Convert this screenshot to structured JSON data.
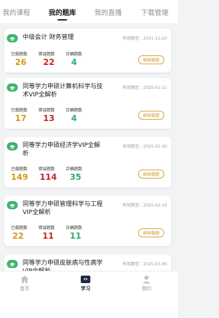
{
  "tabs": [
    {
      "label": "我的课程"
    },
    {
      "label": "我的题库"
    },
    {
      "label": "我的直播"
    },
    {
      "label": "下载管理"
    }
  ],
  "labels": {
    "done": "已做题数",
    "wrong": "错误题数",
    "right": "正确题数",
    "continue": "继续做题"
  },
  "cards": [
    {
      "title": "中级会计 财务管理",
      "valid": "有效期至：2031-12-20",
      "done": "26",
      "wrong": "22",
      "right": "4"
    },
    {
      "title": "同等学力申硕计算机科学与技术VIP全解析",
      "valid": "有效期至：2025-01-11",
      "done": "17",
      "wrong": "13",
      "right": "4"
    },
    {
      "title": "同等学力申硕经济学VIP全解析",
      "valid": "有效期至：2025-01-30",
      "done": "149",
      "wrong": "114",
      "right": "35"
    },
    {
      "title": "同等学力申硕管理科学与工程VIP全解析",
      "valid": "有效期至：2025-02-19",
      "done": "22",
      "wrong": "11",
      "right": "11"
    },
    {
      "title": "同等学力申硕皮肤病与性病学VIP全解析",
      "valid": "有效期至：2025-03-06"
    }
  ],
  "nav": [
    {
      "label": "首页",
      "icon": "home-icon"
    },
    {
      "label": "学习",
      "icon": "study-icon"
    },
    {
      "label": "我的",
      "icon": "user-icon"
    }
  ],
  "colors": {
    "accent": "#3fb46c",
    "done": "#d59a1c",
    "wrong": "#c9252b",
    "right": "#2fae6b",
    "button": "#d4a336"
  }
}
